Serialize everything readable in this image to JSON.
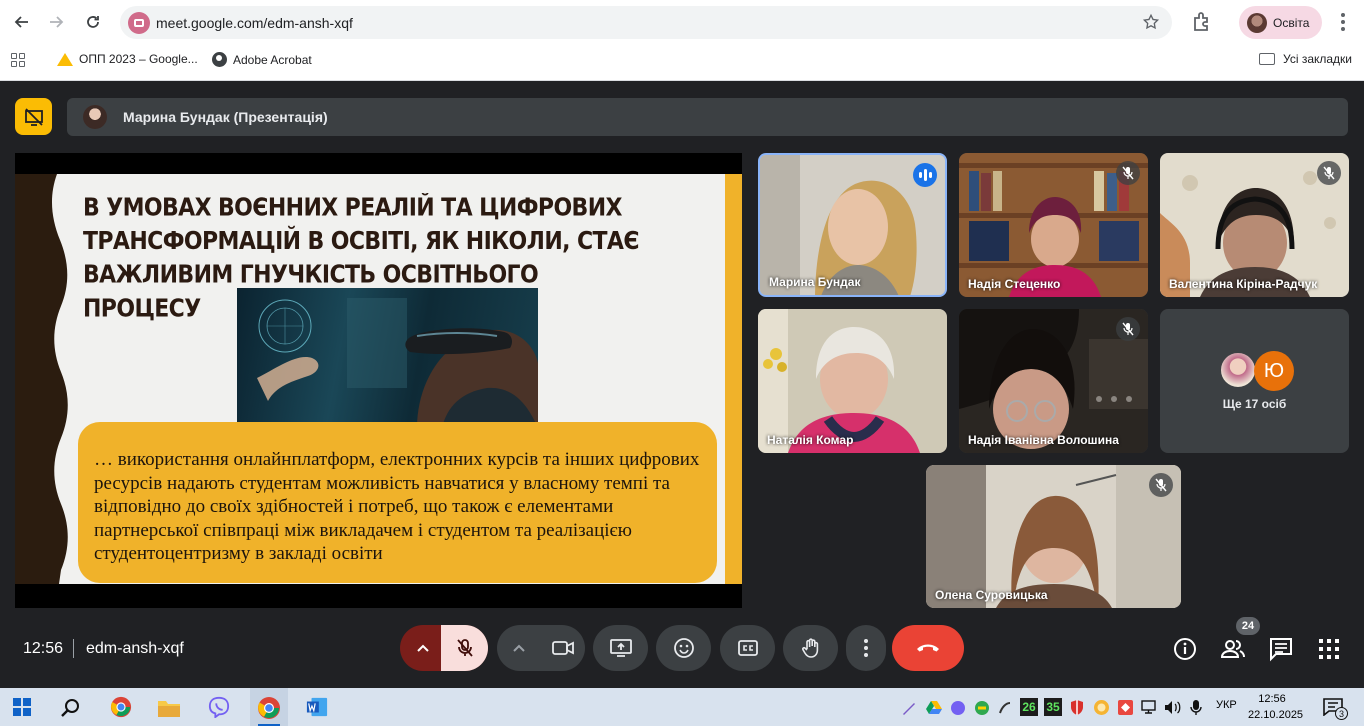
{
  "browser": {
    "url": "meet.google.com/edm-ansh-xqf",
    "profile_name": "Освіта",
    "bookmarks": [
      {
        "label": "ОПП 2023 – Google...",
        "icon": "google-drive-icon"
      },
      {
        "label": "Adobe Acrobat",
        "icon": "globe-icon"
      }
    ],
    "all_bookmarks_label": "Усі закладки"
  },
  "meet": {
    "presenter_banner": "Марина Бундак (Презентація)",
    "slide": {
      "title": "В УМОВАХ ВОЄННИХ РЕАЛІЙ ТА ЦИФРОВИХ ТРАНСФОРМАЦІЙ В ОСВІТІ, ЯК НІКОЛИ, СТАЄ ВАЖЛИВИМ ГНУЧКІСТЬ ОСВІТНЬОГО ПРОЦЕСУ",
      "quote": "… використання онлайнплатформ, електронних курсів та інших цифрових ресурсів надають студентам можливість навчатися у власному темпі та відповідно до своїх здібностей і потреб, що також є елементами партнерської співпраці між викладачем і студентом та реалізацією студентоцентризму в закладі освіти"
    },
    "participants": [
      {
        "name": "Марина Бундак",
        "state": "speaking"
      },
      {
        "name": "Надія Стеценко",
        "state": "muted"
      },
      {
        "name": "Валентина Кіріна-Радчук",
        "state": "muted"
      },
      {
        "name": "Наталія Комар",
        "state": "unmuted"
      },
      {
        "name": "Надія Іванівна Волошина",
        "state": "muted"
      },
      {
        "name": "Олена Суровицька",
        "state": "muted"
      }
    ],
    "others": {
      "label": "Ще 17 осіб",
      "avatar_letter": "Ю"
    },
    "clock": "12:56",
    "meeting_code": "edm-ansh-xqf",
    "people_count": "24",
    "colors": {
      "end_call": "#ea4335",
      "present_accent": "#fbbc04",
      "speaking": "#1a73e8",
      "slide_accent": "#f0b22a"
    }
  },
  "taskbar": {
    "tray_numbers": [
      "26",
      "35"
    ],
    "language": "УКР",
    "time": "12:56",
    "date": "22.10.2025",
    "notification_count": "3"
  }
}
